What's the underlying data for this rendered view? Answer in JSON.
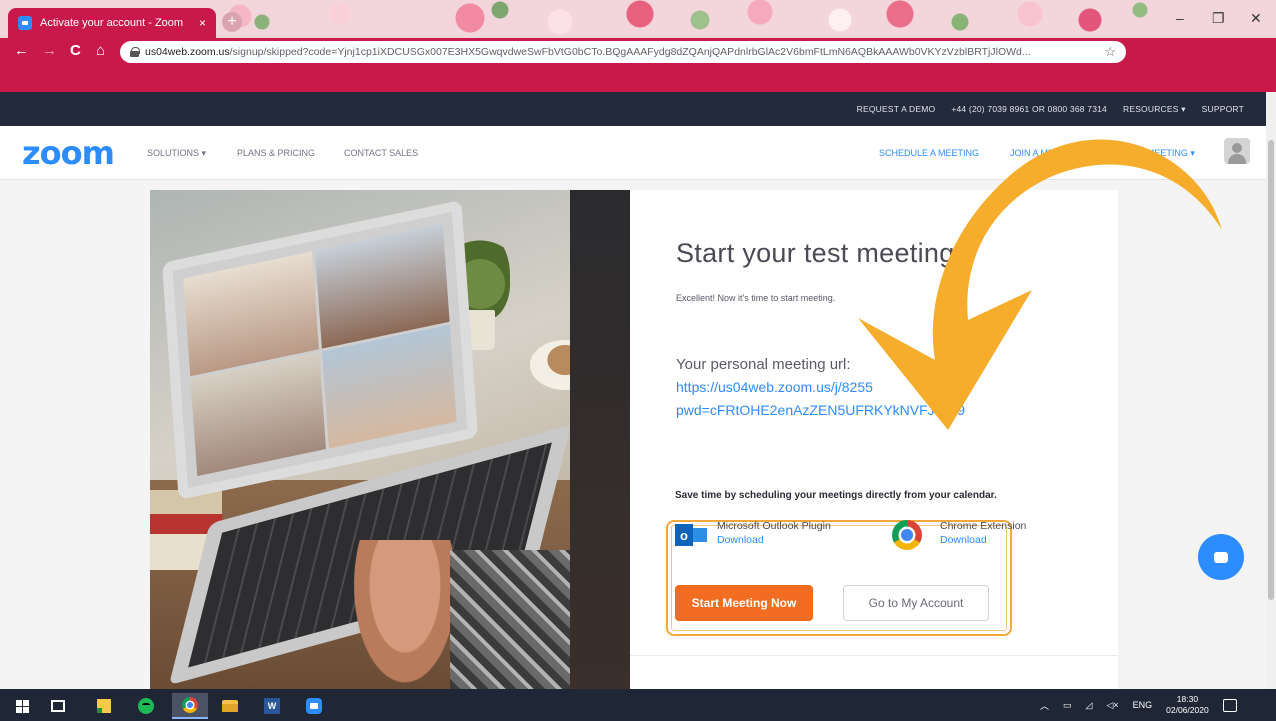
{
  "browser": {
    "tab_title": "Activate your account - Zoom",
    "tab_close": "×",
    "new_tab": "+",
    "url_host": "us04web.zoom.us",
    "url_path": "/signup/skipped?code=Yjnj1cp1iXDCUSGx007E3HX5GwqvdweSwFbVtG0bCTo.BQgAAAFydg8dZQAnjQAPdnlrbGlAc2V6bmFtLmN6AQBkAAAWb0VKYzVzblBRTjJlOWd...",
    "win_minimize": "–",
    "win_restore": "❐",
    "win_close": "✕",
    "back": "←",
    "forward": "→",
    "reload": "C",
    "home": "⌂",
    "star": "☆"
  },
  "topbar": {
    "request_demo": "REQUEST A DEMO",
    "phone": "+44 (20) 7039 8961 OR 0800 368 7314",
    "resources": "RESOURCES ▾",
    "support": "SUPPORT"
  },
  "navbar": {
    "logo": "zoom",
    "solutions": "SOLUTIONS ▾",
    "plans": "PLANS & PRICING",
    "contact": "CONTACT SALES",
    "schedule": "SCHEDULE A MEETING",
    "join": "JOIN A MEETING",
    "host": "HOST A MEETING ▾"
  },
  "card": {
    "title": "Start your test meeting",
    "subtitle": "Excellent! Now it's time to start meeting.",
    "url_label": "Your personal meeting url:",
    "url_line1": "https://us04web.zoom.us/j/8255",
    "url_line2": "pwd=cFRtOHE2enAzZEN5UFRKYkNVFJdz09",
    "start_button": "Start Meeting Now",
    "account_button": "Go to My Account",
    "save_time": "Save time by scheduling your meetings directly from your calendar.",
    "plugins": [
      {
        "name": "Microsoft Outlook Plugin",
        "link": "Download"
      },
      {
        "name": "Chrome Extension",
        "link": "Download"
      }
    ]
  },
  "taskbar": {
    "word_letter": "W",
    "language": "ENG",
    "time": "18:30",
    "date": "02/06/2020"
  },
  "colors": {
    "browser_chrome": "#c9194b",
    "zoom_blue": "#2d8cff",
    "start_button": "#f26d21",
    "arrow": "#f7ad2c",
    "highlight_box": "#f2a83a"
  }
}
